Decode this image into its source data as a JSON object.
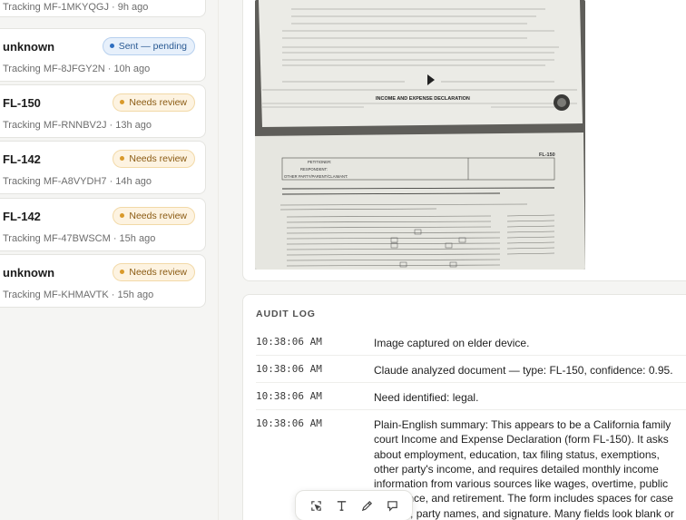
{
  "submissions": [
    {
      "title": "",
      "status": "",
      "tracking": "Tracking MF-1MKYQGJ · 9h ago"
    },
    {
      "title": "unknown",
      "status": "Sent — pending",
      "status_kind": "sent",
      "tracking": "Tracking MF-8JFGY2N · 10h ago"
    },
    {
      "title": "FL-150",
      "status": "Needs review",
      "status_kind": "review",
      "tracking": "Tracking MF-RNNBV2J · 13h ago"
    },
    {
      "title": "FL-142",
      "status": "Needs review",
      "status_kind": "review",
      "tracking": "Tracking MF-A8VYDH7 · 14h ago"
    },
    {
      "title": "FL-142",
      "status": "Needs review",
      "status_kind": "review",
      "tracking": "Tracking MF-47BWSCM · 15h ago"
    },
    {
      "title": "unknown",
      "status": "Needs review",
      "status_kind": "review",
      "tracking": "Tracking MF-KHMAVTK · 15h ago"
    }
  ],
  "document_preview": {
    "heading_1": "INCOME AND EXPENSE DECLARATION",
    "form_code": "FL-150",
    "line_petitioner": "PETITIONER:",
    "line_respondent": "RESPONDENT:",
    "line_other": "OTHER PARTY/PARENT/CLAIMANT:",
    "attach_note": "Attach copies of your pay stubs for the last two months and proof of any other income. Take a copy of your latest federal tax return to the court hearing. (Black out your Social Security number on the pay stub and tax return.)",
    "income_item": "5. Income (For average monthly, add up all the income you received in each category in the last 12 months and divide the total by 12.)",
    "other_party": "4. Other party's income. I estimate the gross monthly income (before taxes) of the other party in this case at (specify): $",
    "declare_text": "I declare under penalty of perjury under the laws of the State of California that the information contained on all pages of this form and any attachments is true and correct."
  },
  "audit": {
    "title": "AUDIT LOG",
    "entries": [
      {
        "time": "10:38:06 AM",
        "message": "Image captured on elder device."
      },
      {
        "time": "10:38:06 AM",
        "message": "Claude analyzed document — type: FL-150, confidence: 0.95."
      },
      {
        "time": "10:38:06 AM",
        "message": "Need identified: legal."
      },
      {
        "time": "10:38:06 AM",
        "message": "Plain-English summary: This appears to be a California family court Income and Expense Declaration (form FL-150). It asks about employment, education, tax filing status, exemptions, other party's income, and requires detailed monthly income information from various sources like wages, overtime, public assistance, and retirement. The form includes spaces for case number, party names, and signature. Many fields look blank or"
      }
    ]
  },
  "toolbar": {
    "icons": [
      "select-region-icon",
      "text-icon",
      "pencil-icon",
      "comment-icon"
    ]
  },
  "colors": {
    "review_bg": "#fdf3e1",
    "review_text": "#8a5a12",
    "sent_bg": "#e7f0fb",
    "sent_text": "#2a5a93"
  }
}
